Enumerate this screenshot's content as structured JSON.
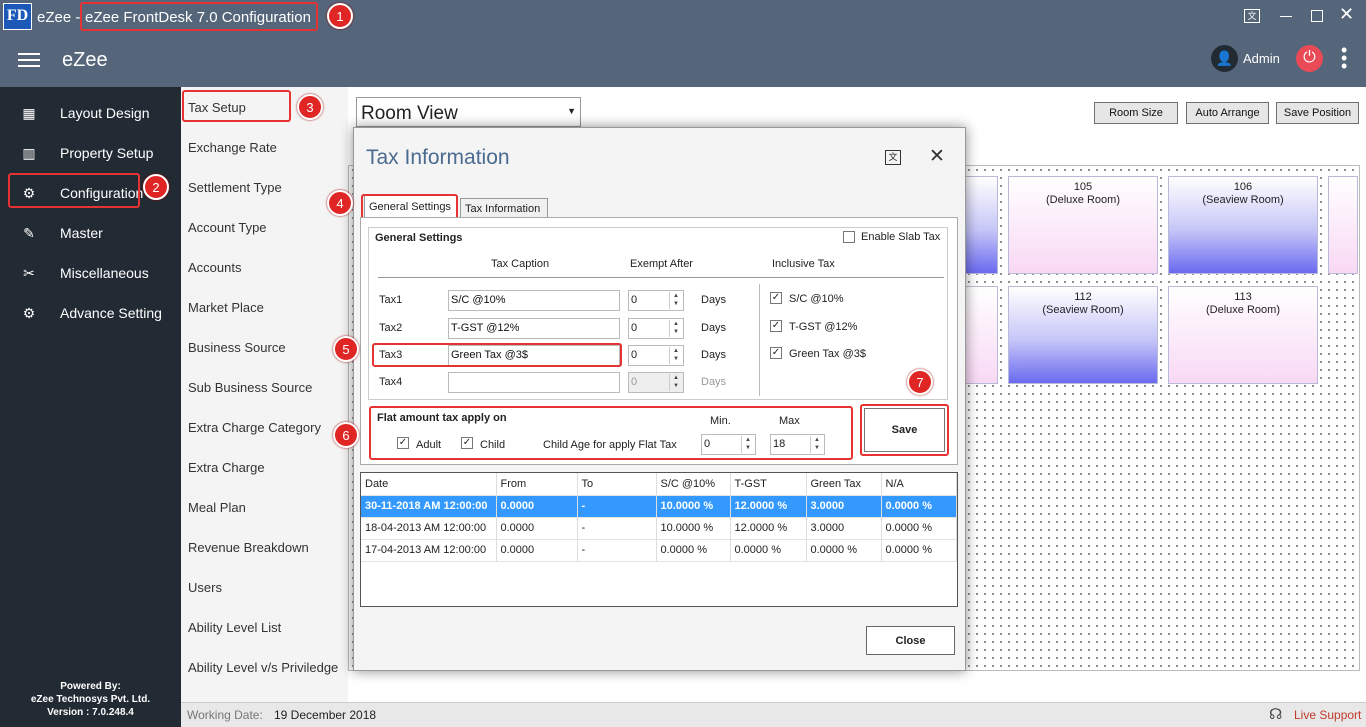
{
  "window": {
    "title_prefix": "eZee - ",
    "title": "eZee FrontDesk 7.0 Configuration",
    "logo": "FD"
  },
  "appbar": {
    "brand": "eZee",
    "user": "Admin"
  },
  "sidebar": {
    "items": [
      {
        "label": "Layout Design",
        "icon": "layout-icon"
      },
      {
        "label": "Property Setup",
        "icon": "building-icon"
      },
      {
        "label": "Configuration",
        "icon": "gear-icon"
      },
      {
        "label": "Master",
        "icon": "master-icon"
      },
      {
        "label": "Miscellaneous",
        "icon": "tools-icon"
      },
      {
        "label": "Advance Setting",
        "icon": "advanced-gear-icon"
      }
    ],
    "footer": {
      "line1": "Powered By:",
      "line2": "eZee Technosys Pvt. Ltd.",
      "line3": "Version : 7.0.248.4"
    }
  },
  "submenu": [
    "Tax Setup",
    "Exchange Rate",
    "Settlement Type",
    "Account Type",
    "Accounts",
    "Market Place",
    "Business Source",
    "Sub Business Source",
    "Extra Charge Category",
    "Extra Charge",
    "Meal Plan",
    "Revenue Breakdown",
    "Users",
    "Ability Level List",
    "Ability Level v/s Priviledge"
  ],
  "canvas": {
    "view_select": "Room View",
    "buttons": {
      "room_size": "Room Size",
      "auto_arrange": "Auto Arrange",
      "save_position": "Save Position"
    },
    "rooms": [
      {
        "num": "105",
        "type": "(Deluxe Room)"
      },
      {
        "num": "106",
        "type": "(Seaview Room)"
      },
      {
        "num": "112",
        "type": "(Seaview Room)"
      },
      {
        "num": "113",
        "type": "(Deluxe Room)"
      }
    ]
  },
  "status": {
    "label": "Working Date:",
    "date": "19 December 2018",
    "support": "Live Support"
  },
  "dialog": {
    "title": "Tax Information",
    "tabs": [
      "General Settings",
      "Tax Information"
    ],
    "group_title": "General Settings",
    "enable_slab": "Enable Slab Tax",
    "headers": {
      "caption": "Tax Caption",
      "exempt": "Exempt After",
      "inclusive": "Inclusive Tax"
    },
    "days": "Days",
    "taxes": [
      {
        "label": "Tax1",
        "caption": "S/C @10%",
        "exempt": "0",
        "inclusive": "S/C @10%",
        "checked": true
      },
      {
        "label": "Tax2",
        "caption": "T-GST @12%",
        "exempt": "0",
        "inclusive": "T-GST @12%",
        "checked": true
      },
      {
        "label": "Tax3",
        "caption": "Green Tax @3$",
        "exempt": "0",
        "inclusive": "Green Tax @3$",
        "checked": true
      },
      {
        "label": "Tax4",
        "caption": "",
        "exempt": "0",
        "inclusive": "",
        "checked": false
      }
    ],
    "flat": {
      "title": "Flat amount tax apply on",
      "adult": "Adult",
      "child": "Child",
      "child_age": "Child Age for apply Flat Tax",
      "min_label": "Min.",
      "max_label": "Max",
      "min": "0",
      "max": "18"
    },
    "save": "Save",
    "close": "Close",
    "grid": {
      "columns": [
        "Date",
        "From",
        "To",
        "S/C @10%",
        "T-GST",
        "Green Tax",
        "N/A"
      ],
      "rows": [
        [
          "30-11-2018 AM 12:00:00",
          "0.0000",
          "-",
          "10.0000 %",
          "12.0000 %",
          "3.0000",
          "0.0000 %"
        ],
        [
          "18-04-2013 AM 12:00:00",
          "0.0000",
          "-",
          "10.0000 %",
          "12.0000 %",
          "3.0000",
          "0.0000 %"
        ],
        [
          "17-04-2013 AM 12:00:00",
          "0.0000",
          "-",
          "0.0000 %",
          "0.0000 %",
          "0.0000 %",
          "0.0000 %"
        ]
      ]
    }
  },
  "badges": [
    "1",
    "2",
    "3",
    "4",
    "5",
    "6",
    "7"
  ]
}
